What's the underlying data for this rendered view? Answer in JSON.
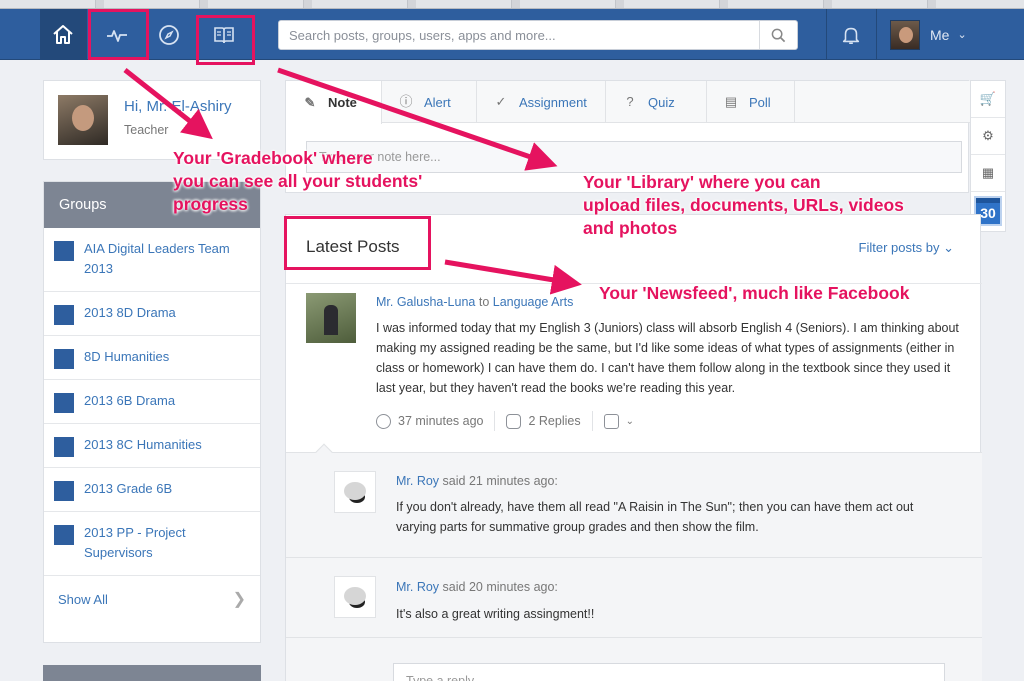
{
  "topbar": {
    "nav": [
      "home-icon",
      "activity-icon",
      "compass-icon",
      "book-icon"
    ],
    "search_placeholder": "Search posts, groups, users, apps and more...",
    "me_label": "Me"
  },
  "profile": {
    "greeting": "Hi, Mr. El-Ashiry",
    "role": "Teacher"
  },
  "groups": {
    "header": "Groups",
    "items": [
      "AIA Digital Leaders Team 2013",
      "2013 8D Drama",
      "8D Humanities",
      "2013 6B Drama",
      "2013 8C Humanities",
      "2013 Grade 6B",
      "2013 PP - Project Supervisors"
    ],
    "show_all": "Show All"
  },
  "composer": {
    "tabs": [
      "Note",
      "Alert",
      "Assignment",
      "Quiz",
      "Poll"
    ],
    "note_placeholder": "Type your note here..."
  },
  "calendar": {
    "day": "30"
  },
  "feed": {
    "title": "Latest Posts",
    "filter": "Filter posts by",
    "post": {
      "author": "Mr. Galusha-Luna",
      "to_word": "to",
      "group": "Language Arts",
      "body": "I was informed today that my English 3 (Juniors) class will absorb English 4 (Seniors). I am thinking about making my assigned reading be the same, but I'd like some ideas of what types of assignments (either in class or homework) I can have them do. I can't have them follow along in the textbook since they used it last year, but they haven't read the books we're reading this year.",
      "time": "37 minutes ago",
      "replies": "2 Replies"
    },
    "comments": [
      {
        "author": "Mr. Roy",
        "said": "said 21 minutes ago:",
        "text": "If you don't already, have them all read \"A Raisin in The Sun\"; then you can have them act out varying parts for summative group grades and then show the film."
      },
      {
        "author": "Mr. Roy",
        "said": "said 20 minutes ago:",
        "text": "It's also a great writing assingment!!"
      }
    ],
    "reply_placeholder": "Type a reply..."
  },
  "annotations": {
    "gradebook": [
      "Your 'Gradebook' where",
      "you can see all your students'",
      "progress"
    ],
    "library": [
      "Your 'Library' where you can",
      "upload files, documents, URLs, videos",
      "and photos"
    ],
    "newsfeed": "Your 'Newsfeed', much like Facebook",
    "color": "#e5135f"
  },
  "colors": {
    "topbar": "#2e5e9e",
    "link": "#3b76b8",
    "group_square": "#2e5e9e"
  }
}
